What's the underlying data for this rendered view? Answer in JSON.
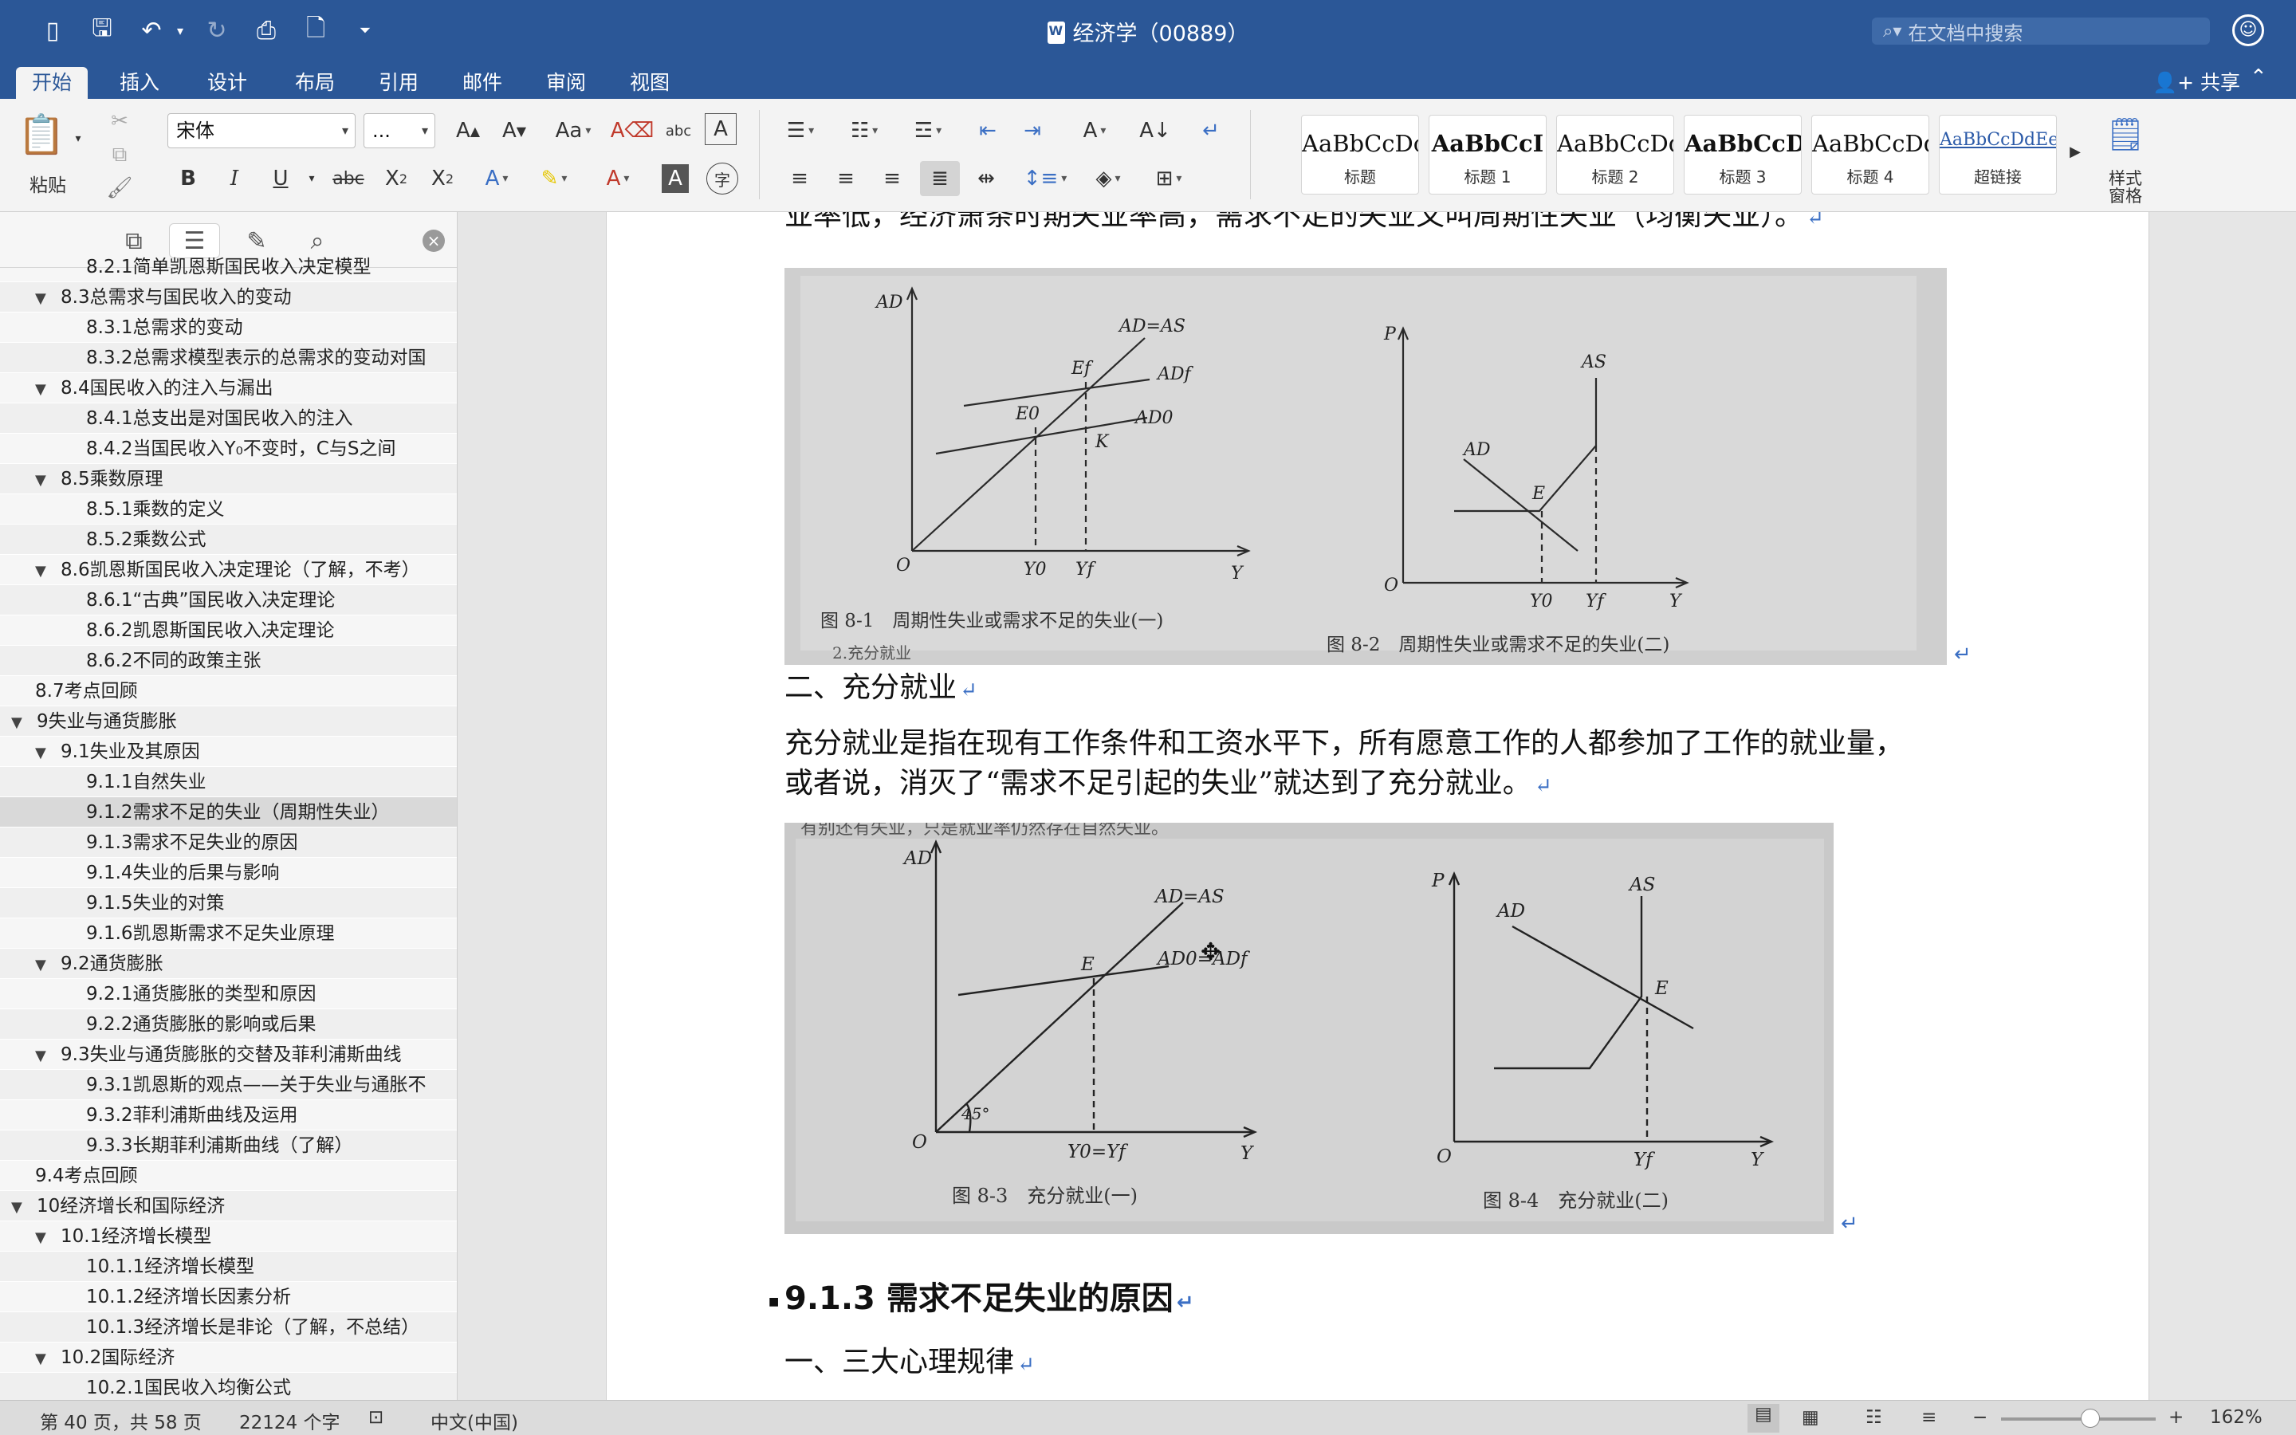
{
  "titlebar": {
    "title": "经济学（00889）",
    "search_placeholder": "在文档中搜索"
  },
  "tabs": [
    "开始",
    "插入",
    "设计",
    "布局",
    "引用",
    "邮件",
    "审阅",
    "视图"
  ],
  "share_label": "共享",
  "ribbon": {
    "paste_label": "粘贴",
    "font_name": "宋体",
    "font_size": "...",
    "styles": [
      {
        "sample": "AaBbCcDc",
        "name": "标题"
      },
      {
        "sample": "AaBbCcI",
        "name": "标题 1"
      },
      {
        "sample": "AaBbCcDdI",
        "name": "标题 2"
      },
      {
        "sample": "AaBbCcDc",
        "name": "标题 3"
      },
      {
        "sample": "AaBbCcDdE",
        "name": "标题 4"
      },
      {
        "sample": "AaBbCcDdEe",
        "name": "超链接"
      }
    ],
    "styles_pane_label": "样式\n窗格"
  },
  "outline": [
    {
      "level": 2,
      "label": "8.2.1简单凯恩斯国民收入决定模型",
      "partial": true
    },
    {
      "level": 1,
      "label": "8.3总需求与国民收入的变动",
      "expanded": true
    },
    {
      "level": 2,
      "label": "8.3.1总需求的变动"
    },
    {
      "level": 2,
      "label": "8.3.2总需求模型表示的总需求的变动对国"
    },
    {
      "level": 1,
      "label": "8.4国民收入的注入与漏出",
      "expanded": true
    },
    {
      "level": 2,
      "label": "8.4.1总支出是对国民收入的注入"
    },
    {
      "level": 2,
      "label": "8.4.2当国民收入Y₀不变时，C与S之间"
    },
    {
      "level": 1,
      "label": "8.5乘数原理",
      "expanded": true
    },
    {
      "level": 2,
      "label": "8.5.1乘数的定义"
    },
    {
      "level": 2,
      "label": "8.5.2乘数公式"
    },
    {
      "level": 1,
      "label": "8.6凯恩斯国民收入决定理论（了解，不考）",
      "expanded": true
    },
    {
      "level": 2,
      "label": "8.6.1“古典”国民收入决定理论"
    },
    {
      "level": 2,
      "label": "8.6.2凯恩斯国民收入决定理论"
    },
    {
      "level": 2,
      "label": "8.6.2不同的政策主张"
    },
    {
      "level": 1,
      "label": "8.7考点回顾"
    },
    {
      "level": 0,
      "label": "9失业与通货膨胀",
      "expanded": true
    },
    {
      "level": 1,
      "label": "9.1失业及其原因",
      "expanded": true
    },
    {
      "level": 2,
      "label": "9.1.1自然失业"
    },
    {
      "level": 2,
      "label": "9.1.2需求不足的失业（周期性失业）",
      "selected": true
    },
    {
      "level": 2,
      "label": "9.1.3需求不足失业的原因"
    },
    {
      "level": 2,
      "label": "9.1.4失业的后果与影响"
    },
    {
      "level": 2,
      "label": "9.1.5失业的对策"
    },
    {
      "level": 2,
      "label": "9.1.6凯恩斯需求不足失业原理"
    },
    {
      "level": 1,
      "label": "9.2通货膨胀",
      "expanded": true
    },
    {
      "level": 2,
      "label": "9.2.1通货膨胀的类型和原因"
    },
    {
      "level": 2,
      "label": "9.2.2通货膨胀的影响或后果"
    },
    {
      "level": 1,
      "label": "9.3失业与通货膨胀的交替及菲利浦斯曲线",
      "expanded": true
    },
    {
      "level": 2,
      "label": "9.3.1凯恩斯的观点——关于失业与通胀不"
    },
    {
      "level": 2,
      "label": "9.3.2菲利浦斯曲线及运用"
    },
    {
      "level": 2,
      "label": "9.3.3长期菲利浦斯曲线（了解）"
    },
    {
      "level": 1,
      "label": "9.4考点回顾"
    },
    {
      "level": 0,
      "label": "10经济增长和国际经济",
      "expanded": true
    },
    {
      "level": 1,
      "label": "10.1经济增长模型",
      "expanded": true
    },
    {
      "level": 2,
      "label": "10.1.1经济增长模型"
    },
    {
      "level": 2,
      "label": "10.1.2经济增长因素分析"
    },
    {
      "level": 2,
      "label": "10.1.3经济增长是非论（了解，不总结）"
    },
    {
      "level": 1,
      "label": "10.2国际经济",
      "expanded": true
    },
    {
      "level": 2,
      "label": "10.2.1国民收入均衡公式",
      "partial": true
    }
  ],
  "document": {
    "para_top": "业率低，经济萧条时期失业率高，需求不足的失业又叫周期性失业（均衡失业）。",
    "section2_title": "二、充分就业",
    "full_employment_line1": "充分就业是指在现有工作条件和工资水平下，所有愿意工作的人都参加了工作的就业量，",
    "full_employment_line2": "或者说，消灭了“需求不足引起的失业”就达到了充分就业。",
    "heading_913": "9.1.3 需求不足失业的原因",
    "sub_heading_1": "一、三大心理规律"
  },
  "figure1": {
    "left_caption": "图 8-1　周期性失业或需求不足的失业(一)",
    "right_caption": "图 8-2　周期性失业或需求不足的失业(二)",
    "fragment": "2.充分就业",
    "left_labels": {
      "y_axis": "AD",
      "x_axis": "Y",
      "origin": "O",
      "line_45": "AD=AS",
      "curve_f": "ADf",
      "curve_0": "AD0",
      "e0": "E0",
      "ef": "Ef",
      "k": "K",
      "y0": "Y0",
      "yf": "Yf"
    },
    "right_labels": {
      "y_axis": "P",
      "x_axis": "Y",
      "origin": "O",
      "as": "AS",
      "ad": "AD",
      "e": "E",
      "y0": "Y0",
      "yf": "Yf"
    }
  },
  "figure2": {
    "top_fragment": "有别还有失业，只是就业率仍然存在自然失业。",
    "left_caption": "图 8-3　充分就业(一)",
    "right_caption": "图 8-4　充分就业(二)",
    "left_labels": {
      "y_axis": "AD",
      "x_axis": "Y",
      "origin": "O",
      "line_45": "AD=AS",
      "curve": "AD0=ADf",
      "e": "E",
      "angle": "45°",
      "yline": "Y0=Yf"
    },
    "right_labels": {
      "y_axis": "P",
      "x_axis": "Y",
      "origin": "O",
      "as": "AS",
      "ad": "AD",
      "e": "E",
      "yf": "Yf"
    }
  },
  "statusbar": {
    "page_info": "第 40 页，共 58 页",
    "word_count": "22124 个字",
    "language": "中文(中国)",
    "zoom": "162%"
  }
}
